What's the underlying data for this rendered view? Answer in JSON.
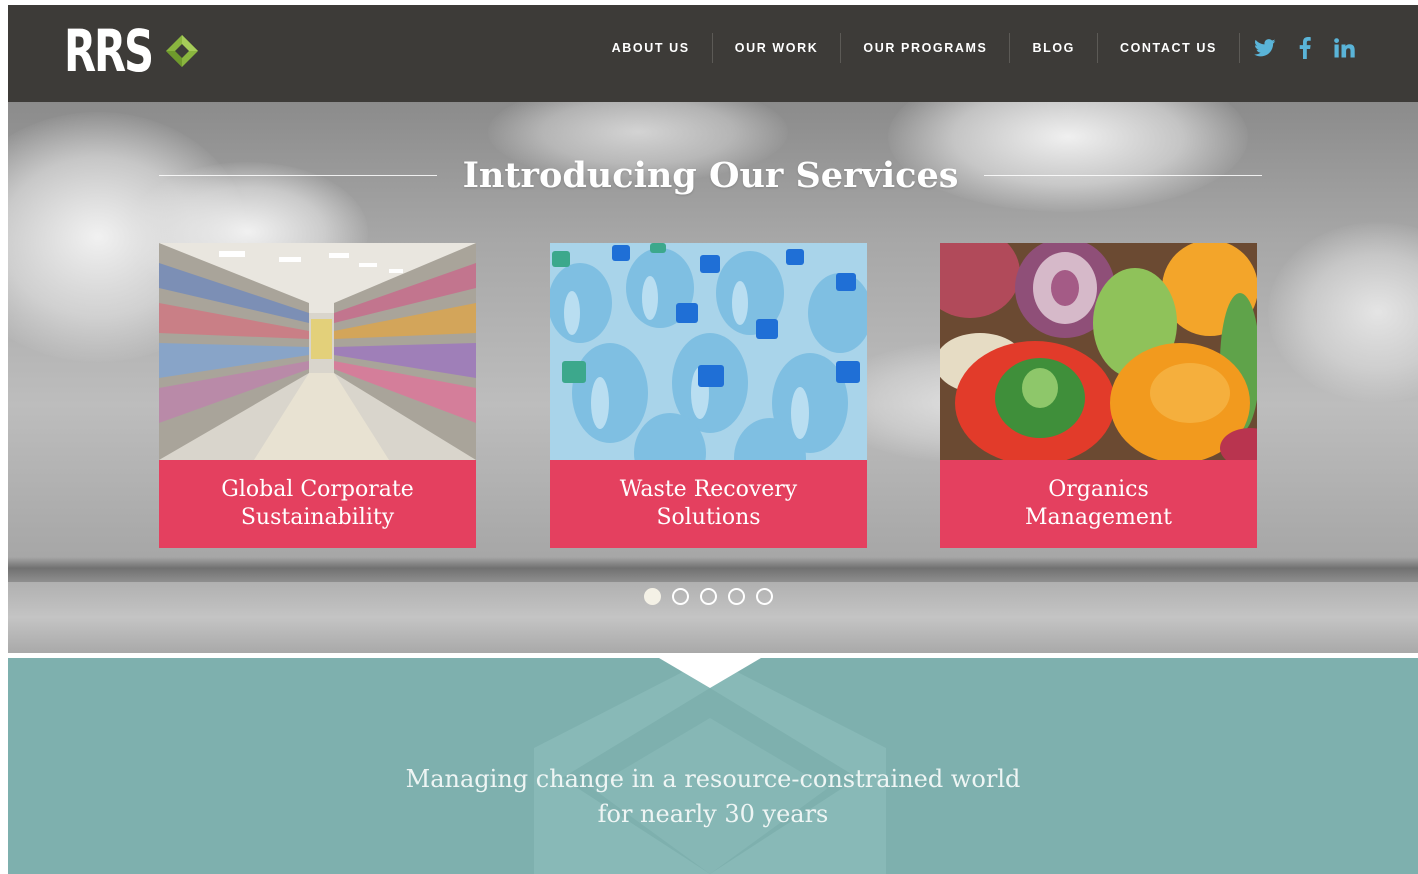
{
  "brand": {
    "logo_text": "RRS",
    "accent_color": "#8ab53f",
    "header_bg": "#3d3b38",
    "icon": "diamond-logo-icon"
  },
  "nav": {
    "items": [
      {
        "label": "ABOUT US"
      },
      {
        "label": "OUR WORK"
      },
      {
        "label": "OUR PROGRAMS"
      },
      {
        "label": "BLOG"
      },
      {
        "label": "CONTACT US"
      }
    ],
    "social": [
      {
        "icon": "twitter-icon",
        "color": "#5ab4d8"
      },
      {
        "icon": "facebook-icon",
        "color": "#5ab4d8"
      },
      {
        "icon": "linkedin-icon",
        "color": "#5ab4d8"
      }
    ]
  },
  "hero": {
    "title": "Introducing Our Services",
    "cards": [
      {
        "label_line1": "Global Corporate",
        "label_line2": "Sustainability",
        "image": "supermarket-aisle-photo"
      },
      {
        "label_line1": "Waste Recovery",
        "label_line2": "Solutions",
        "image": "plastic-bottles-photo"
      },
      {
        "label_line1": "Organics",
        "label_line2": "Management",
        "image": "food-scraps-photo"
      }
    ],
    "card_label_color": "#e4405f",
    "carousel": {
      "total": 5,
      "active": 1
    }
  },
  "band": {
    "bg_color": "#7eb0ae",
    "tagline_line1": "Managing change in a resource-constrained world",
    "tagline_line2": "for nearly 30 years"
  }
}
